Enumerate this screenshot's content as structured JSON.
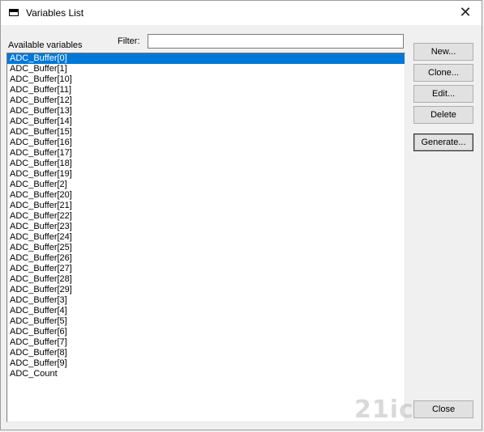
{
  "window": {
    "title": "Variables List",
    "close_glyph": "✕"
  },
  "labels": {
    "available_variables": "Available variables",
    "filter": "Filter:"
  },
  "filter": {
    "value": ""
  },
  "variables": [
    "ADC_Buffer[0]",
    "ADC_Buffer[1]",
    "ADC_Buffer[10]",
    "ADC_Buffer[11]",
    "ADC_Buffer[12]",
    "ADC_Buffer[13]",
    "ADC_Buffer[14]",
    "ADC_Buffer[15]",
    "ADC_Buffer[16]",
    "ADC_Buffer[17]",
    "ADC_Buffer[18]",
    "ADC_Buffer[19]",
    "ADC_Buffer[2]",
    "ADC_Buffer[20]",
    "ADC_Buffer[21]",
    "ADC_Buffer[22]",
    "ADC_Buffer[23]",
    "ADC_Buffer[24]",
    "ADC_Buffer[25]",
    "ADC_Buffer[26]",
    "ADC_Buffer[27]",
    "ADC_Buffer[28]",
    "ADC_Buffer[29]",
    "ADC_Buffer[3]",
    "ADC_Buffer[4]",
    "ADC_Buffer[5]",
    "ADC_Buffer[6]",
    "ADC_Buffer[7]",
    "ADC_Buffer[8]",
    "ADC_Buffer[9]",
    "ADC_Count"
  ],
  "selected_index": 0,
  "buttons": {
    "new": "New...",
    "clone": "Clone...",
    "edit": "Edit...",
    "delete": "Delete",
    "generate": "Generate...",
    "close": "Close"
  },
  "watermark": "21ic",
  "colors": {
    "selection": "#0078d7",
    "dialog_bg": "#f0f0f0"
  }
}
